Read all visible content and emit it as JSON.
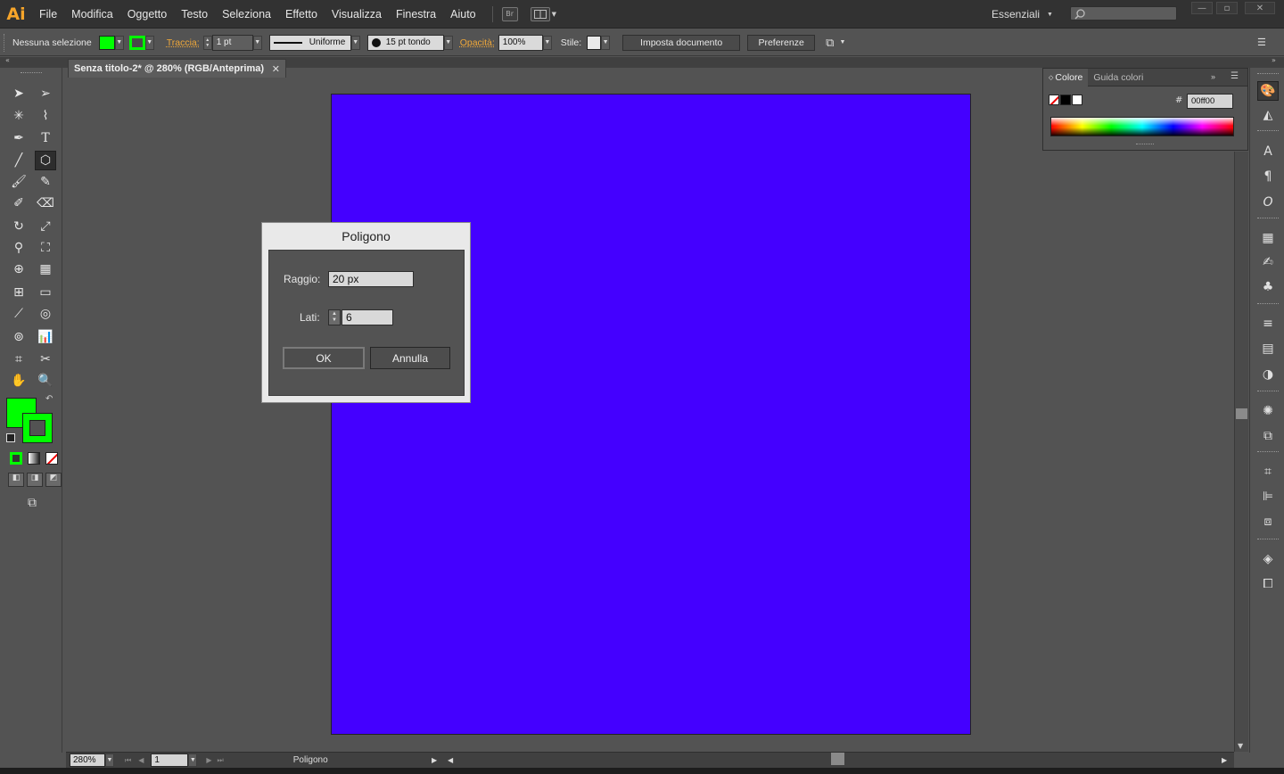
{
  "app": {
    "logo": "Ai"
  },
  "menu": [
    "File",
    "Modifica",
    "Oggetto",
    "Testo",
    "Seleziona",
    "Effetto",
    "Visualizza",
    "Finestra",
    "Aiuto"
  ],
  "menubar": {
    "bridge_label": "Br",
    "workspace": "Essenziali"
  },
  "control": {
    "selection": "Nessuna selezione",
    "fill_color": "#00ff00",
    "stroke_color": "#00ff00",
    "stroke_label": "Traccia:",
    "stroke_weight": "1 pt",
    "profile": "Uniforme",
    "brush": "15 pt tondo",
    "opacity_label": "Opacità:",
    "opacity": "100%",
    "style_label": "Stile:",
    "doc_setup": "Imposta documento",
    "prefs": "Preferenze"
  },
  "document": {
    "tab_title": "Senza titolo-2* @ 280% (RGB/Anteprima)",
    "artboard_color": "#4400ff"
  },
  "color_panel": {
    "tabs": [
      "Colore",
      "Guida colori"
    ],
    "hex_label": "#",
    "hex": "00ff00"
  },
  "dialog": {
    "title": "Poligono",
    "radius_label": "Raggio:",
    "radius": "20 px",
    "sides_label": "Lati:",
    "sides": "6",
    "ok": "OK",
    "cancel": "Annulla"
  },
  "status": {
    "zoom": "280%",
    "page": "1",
    "tool": "Poligono"
  }
}
